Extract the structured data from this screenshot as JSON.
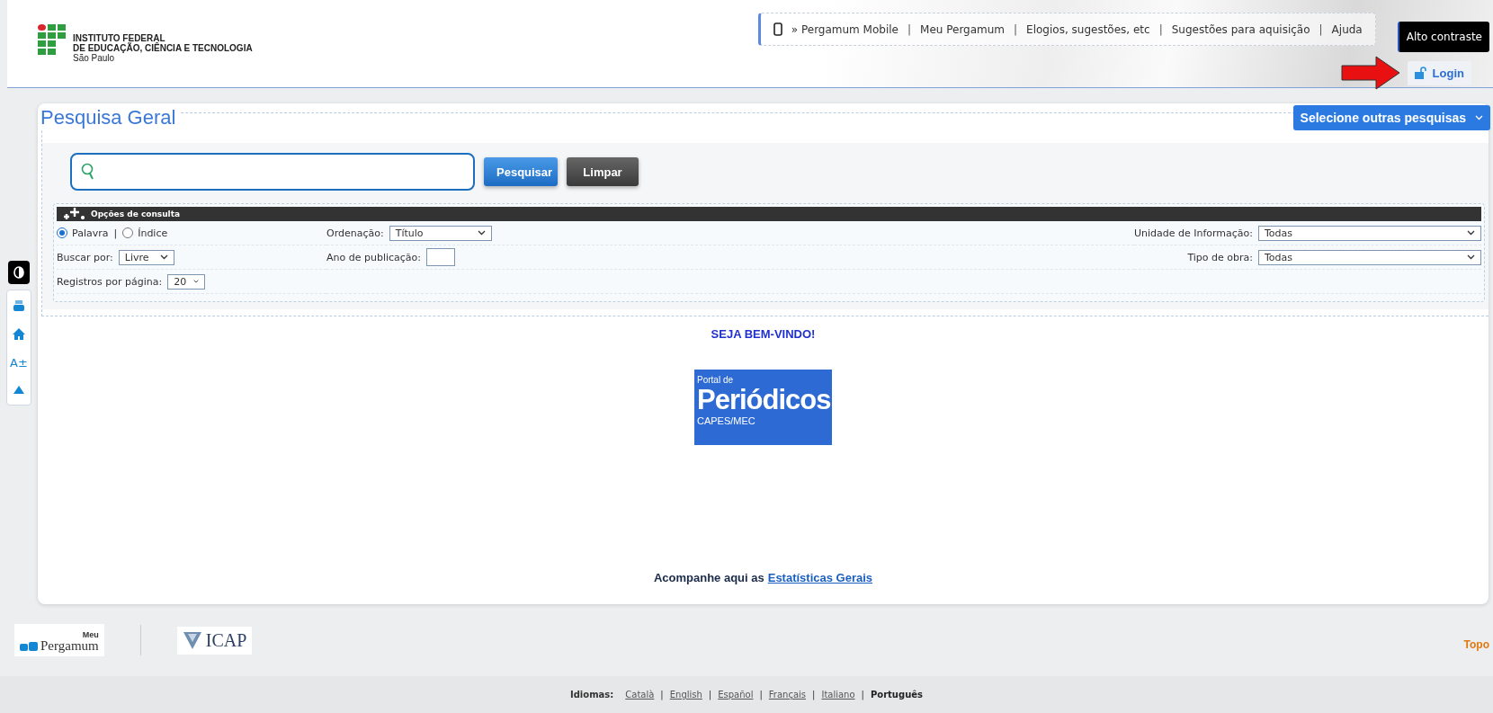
{
  "header": {
    "logo_lines": [
      "INSTITUTO FEDERAL",
      "DE EDUCAÇÃO, CIÊNCIA E TECNOLOGIA",
      "São Paulo"
    ],
    "top_links": [
      "» Pergamum Mobile",
      "Meu Pergamum",
      "Elogios, sugestões, etc",
      "Sugestões para aquisição",
      "Ajuda"
    ],
    "top_links_separator": "|",
    "contrast_button": "Alto contraste",
    "login_button": "Login"
  },
  "side_toolbar": {
    "font_size_button": "A±"
  },
  "search": {
    "title": "Pesquisa Geral",
    "other_searches": "Selecione outras pesquisas",
    "buttons": [
      "Pesquisar",
      "Limpar"
    ],
    "options": {
      "title": "Opções de consulta",
      "radios": [
        {
          "label": "Palavra",
          "selected": true
        },
        {
          "label": "Índice",
          "selected": false
        }
      ],
      "radio_separator": "|",
      "ordering": {
        "label": "Ordenação:",
        "value": "Título"
      },
      "search_by": {
        "label": "Buscar por:",
        "value": "Livre"
      },
      "year": {
        "label": "Ano de publicação:"
      },
      "per_page": {
        "label": "Registros por página:",
        "value": "20"
      },
      "unit": {
        "label": "Unidade de Informação:",
        "value": "Todas"
      },
      "work_type": {
        "label": "Tipo de obra:",
        "value": "Todas"
      }
    }
  },
  "welcome": "SEJA BEM-VINDO!",
  "banner": {
    "lines": [
      "Portal de",
      "Periódicos",
      "CAPES/MEC"
    ]
  },
  "stats": {
    "text": "Acompanhe aqui as",
    "link": "Estatísticas Gerais"
  },
  "footer": {
    "pergamum_logo": [
      "Meu",
      "Pergamum"
    ],
    "icap_logo": "ICAP",
    "top_link": "Topo"
  },
  "languages": {
    "label": "Idiomas:",
    "items": [
      {
        "label": "Català",
        "selected": false
      },
      {
        "label": "English",
        "selected": false
      },
      {
        "label": "Español",
        "selected": false
      },
      {
        "label": "Français",
        "selected": false
      },
      {
        "label": "Italiano",
        "selected": false
      },
      {
        "label": "Português",
        "selected": true
      }
    ],
    "separator": "|"
  }
}
